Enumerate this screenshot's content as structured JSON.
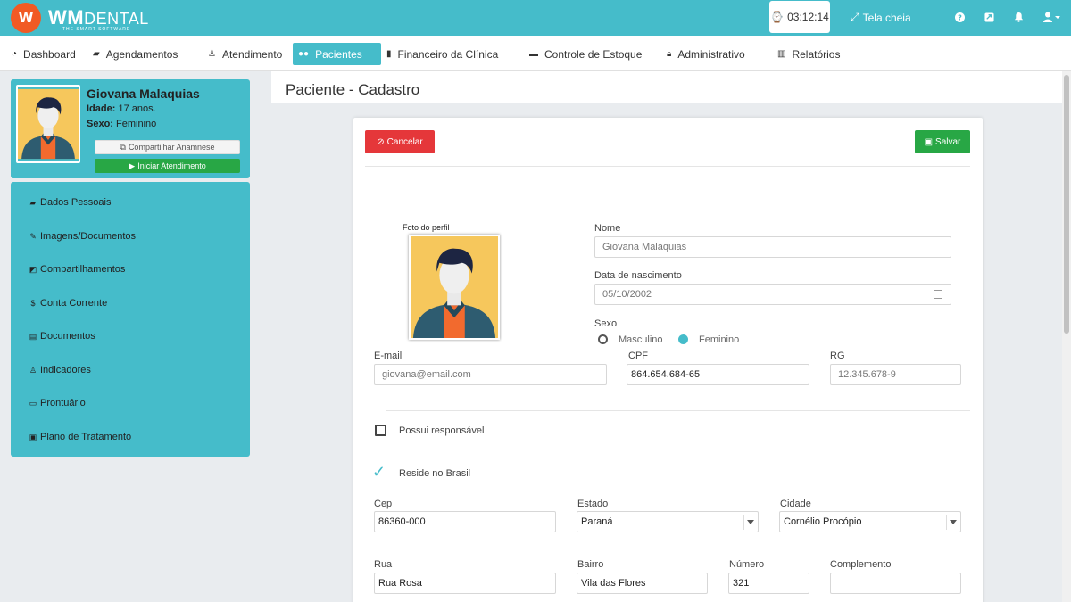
{
  "colors": {
    "brand": "#45bcca",
    "logo_orange": "#f15a24",
    "save_green": "#28a745",
    "cancel_red": "#e5373a"
  },
  "app": {
    "logo_mark": "W",
    "logo_name": "WM",
    "logo_name2": "DENTAL",
    "logo_tagline": "THE SMART SOFTWARE"
  },
  "topbar": {
    "timer": "03:12:14",
    "timer_icon": "stopwatch-icon",
    "fullscreen_label": "Tela cheia",
    "icons": [
      "help-icon",
      "screen-icon",
      "bell-icon",
      "user-icon"
    ]
  },
  "nav": {
    "items": [
      {
        "label": "Dashboard",
        "icon": "dashboard-icon"
      },
      {
        "label": "Agendamentos",
        "icon": "book-icon"
      },
      {
        "label": "Atendimento",
        "icon": "doctor-icon"
      },
      {
        "label": "Pacientes",
        "icon": "users-icon",
        "active": true
      },
      {
        "label": "Financeiro da Clínica",
        "icon": "bookmark-icon"
      },
      {
        "label": "Controle de Estoque",
        "icon": "box-icon"
      },
      {
        "label": "Administrativo",
        "icon": "lock-icon"
      },
      {
        "label": "Relatórios",
        "icon": "bar-chart-icon"
      }
    ]
  },
  "patient": {
    "name": "Giovana Malaquias",
    "age_label": "Idade:",
    "age_value": "17 anos.",
    "sex_label": "Sexo:",
    "sex_value": "Feminino",
    "share_button": "Compartilhar Anamnese",
    "start_button": "Iniciar Atendimento"
  },
  "sidemenu": {
    "items": [
      {
        "label": "Dados Pessoais",
        "icon": "book-icon"
      },
      {
        "label": "Imagens/Documentos",
        "icon": "paperclip-icon"
      },
      {
        "label": "Compartilhamentos",
        "icon": "share-icon"
      },
      {
        "label": "Conta Corrente",
        "icon": "dollar-icon"
      },
      {
        "label": "Documentos",
        "icon": "file-icon"
      },
      {
        "label": "Indicadores",
        "icon": "user-chart-icon"
      },
      {
        "label": "Prontuário",
        "icon": "card-icon"
      },
      {
        "label": "Plano de Tratamento",
        "icon": "money-icon"
      }
    ]
  },
  "page": {
    "title": "Paciente - Cadastro"
  },
  "form": {
    "cancel_button": "Cancelar",
    "save_button": "Salvar",
    "photo_label": "Foto do perfil",
    "nome_label": "Nome",
    "nome_value": "Giovana Malaquias",
    "nasc_label": "Data de nascimento",
    "nasc_value": "05/10/2002",
    "sexo_label": "Sexo",
    "sexo_options": [
      "Masculino",
      "Feminino"
    ],
    "sexo_selected": "Feminino",
    "email_label": "E-mail",
    "email_value": "giovana@email.com",
    "cpf_label": "CPF",
    "cpf_value": "864.654.684-65",
    "rg_label": "RG",
    "rg_value": "12.345.678-9",
    "responsavel_label": "Possui responsável",
    "responsavel_checked": false,
    "brasil_label": "Reside no Brasil",
    "brasil_checked": true,
    "cep_label": "Cep",
    "cep_value": "86360-000",
    "estado_label": "Estado",
    "estado_value": "Paraná",
    "cidade_label": "Cidade",
    "cidade_value": "Cornélio Procópio",
    "rua_label": "Rua",
    "rua_value": "Rua Rosa",
    "bairro_label": "Bairro",
    "bairro_value": "Vila das Flores",
    "numero_label": "Número",
    "numero_value": "321",
    "complemento_label": "Complemento",
    "complemento_value": ""
  }
}
